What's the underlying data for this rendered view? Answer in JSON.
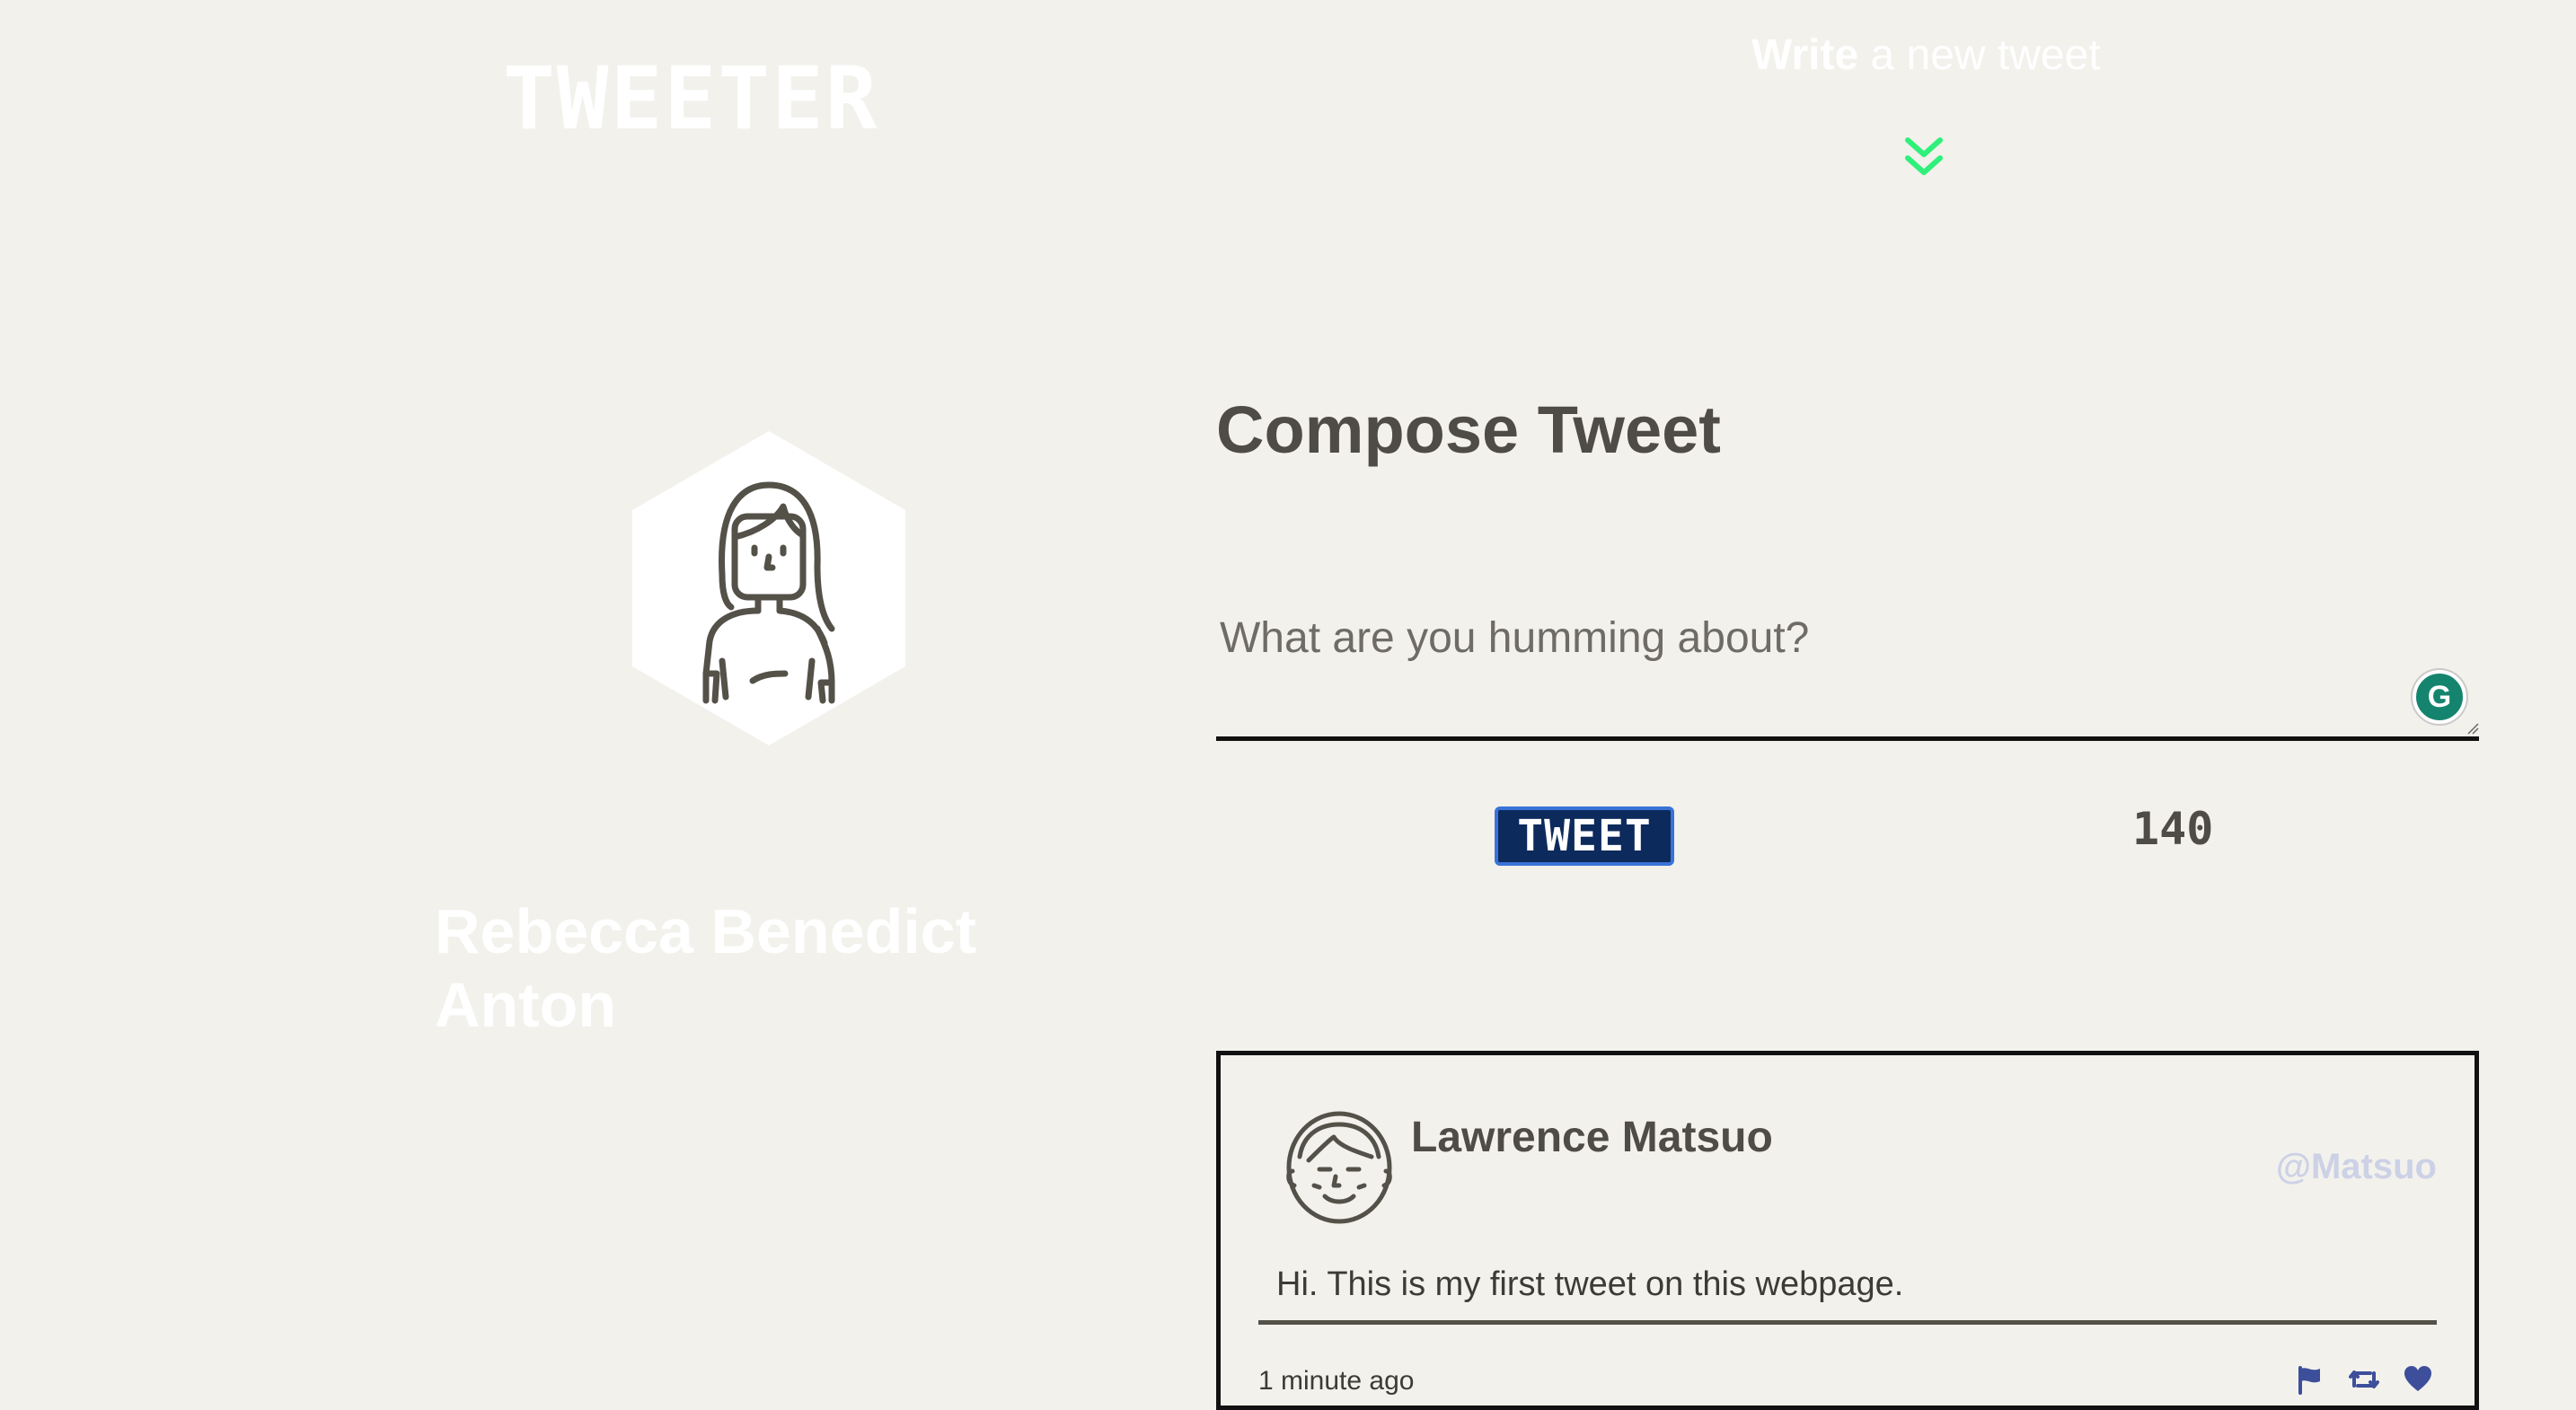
{
  "nav": {
    "brand": "TWEETER",
    "write_em": "Write",
    "write_rest": " a new tweet",
    "arrow_icon": "double-chevron-down-icon",
    "arrow_color": "#2ef07a"
  },
  "profile": {
    "name": "Rebecca Benedict Anton",
    "avatar_icon": "woman-avatar-icon"
  },
  "compose": {
    "title": "Compose Tweet",
    "placeholder": "What are you humming about?",
    "value": "",
    "grammarly_icon": "grammarly-g-icon",
    "grammarly_letter": "G",
    "tweet_button": "TWEET",
    "counter": "140"
  },
  "tweets": [
    {
      "author": "Lawrence Matsuo",
      "handle": "@Matsuo",
      "text": "Hi. This is my first tweet on this webpage.",
      "time": "1 minute ago",
      "avatar_icon": "man-avatar-icon",
      "actions": [
        "flag-icon",
        "retweet-icon",
        "heart-icon"
      ]
    }
  ],
  "colors": {
    "background": "#f2f1ec",
    "text": "#545149",
    "button_bg": "#0d2a5d",
    "button_border": "#3a73d8",
    "handle": "#ccd1e6",
    "action_icons": "#3d4f9a"
  }
}
